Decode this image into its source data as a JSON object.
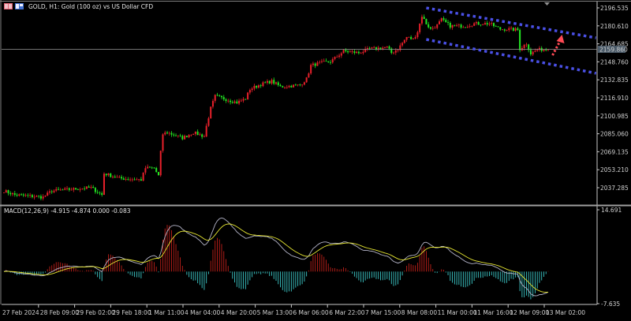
{
  "window": {
    "title": "GOLD, H1:  Gold (100 oz) vs US Dollar CFD",
    "icons": [
      "chart-window-icon",
      "chart-properties-icon"
    ]
  },
  "colors": {
    "background": "#000000",
    "bull_candle": "#e8202a",
    "bear_candle": "#22e622",
    "channel": "#4a50e6",
    "arrow": "#ff4a55",
    "macd_line": "#b4b4c8",
    "signal_line": "#e6e632",
    "hist_positive": "#c0201a",
    "hist_negative": "#3cc8c8",
    "axis": "#c8c8c8"
  },
  "chart_data": [
    {
      "type": "candlestick",
      "title": "GOLD, H1",
      "ylim": [
        2025,
        2199
      ],
      "price_ticks": [
        "2196.535",
        "2180.610",
        "2164.685",
        "2148.760",
        "2132.835",
        "2116.910",
        "2100.985",
        "2085.060",
        "2069.135",
        "2053.210",
        "2037.285"
      ],
      "current_price": "2159.860",
      "bars": 251,
      "close_keypoints": [
        [
          0,
          2034.5
        ],
        [
          5,
          2031.0
        ],
        [
          18,
          2028.9
        ],
        [
          22,
          2034.5
        ],
        [
          40,
          2037.3
        ],
        [
          45,
          2031.0
        ],
        [
          46,
          2049.9
        ],
        [
          53,
          2045.6
        ],
        [
          63,
          2044.3
        ],
        [
          65,
          2054.7
        ],
        [
          69,
          2054.7
        ],
        [
          71,
          2047.7
        ],
        [
          72,
          2068.7
        ],
        [
          73,
          2084.8
        ],
        [
          75,
          2086.2
        ],
        [
          82,
          2081.3
        ],
        [
          87,
          2086.2
        ],
        [
          92,
          2082.7
        ],
        [
          93,
          2091.8
        ],
        [
          95,
          2107.8
        ],
        [
          97,
          2118.3
        ],
        [
          101,
          2116.2
        ],
        [
          107,
          2112.7
        ],
        [
          111,
          2116.2
        ],
        [
          113,
          2124.6
        ],
        [
          118,
          2128.8
        ],
        [
          123,
          2131.6
        ],
        [
          127,
          2126.7
        ],
        [
          136,
          2128.1
        ],
        [
          139,
          2133.7
        ],
        [
          141,
          2145.5
        ],
        [
          145,
          2147.6
        ],
        [
          150,
          2149.0
        ],
        [
          156,
          2158.1
        ],
        [
          163,
          2156.7
        ],
        [
          168,
          2160.2
        ],
        [
          176,
          2161.6
        ],
        [
          178,
          2156.7
        ],
        [
          181,
          2160.2
        ],
        [
          185,
          2170.7
        ],
        [
          188,
          2168.6
        ],
        [
          190,
          2175.6
        ],
        [
          192,
          2189.5
        ],
        [
          194,
          2182.6
        ],
        [
          196,
          2177.7
        ],
        [
          199,
          2181.2
        ],
        [
          201,
          2186.1
        ],
        [
          205,
          2180.5
        ],
        [
          212,
          2180.5
        ],
        [
          216,
          2182.6
        ],
        [
          223,
          2182.6
        ],
        [
          228,
          2177.7
        ],
        [
          232,
          2177.7
        ],
        [
          236,
          2177.0
        ],
        [
          237,
          2160.2
        ],
        [
          240,
          2165.1
        ],
        [
          242,
          2156.0
        ],
        [
          245,
          2159.5
        ],
        [
          250,
          2159.86
        ]
      ],
      "annotations": {
        "channel_upper": [
          [
            194,
            2196.5
          ],
          [
            272,
            2170.0
          ]
        ],
        "channel_lower": [
          [
            194,
            2168.6
          ],
          [
            272,
            2138.6
          ]
        ],
        "forecast_arrow": [
          [
            252,
            2154.6
          ],
          [
            256,
            2170.7
          ]
        ]
      },
      "time_labels": [
        "27 Feb 2024",
        "28 Feb 09:00",
        "29 Feb 02:00",
        "29 Feb 18:00",
        "1 Mar 11:00",
        "4 Mar 04:00",
        "4 Mar 20:00",
        "5 Mar 13:00",
        "6 Mar 06:00",
        "6 Mar 22:00",
        "7 Mar 15:00",
        "8 Mar 08:00",
        "11 Mar 00:00",
        "11 Mar 16:00",
        "12 Mar 09:00",
        "13 Mar 02:00"
      ]
    },
    {
      "type": "line",
      "title": "MACD(12,26,9) -4.915 -4.874 0.000 -0.083",
      "params": {
        "fast": 12,
        "slow": 26,
        "signal": 9
      },
      "ylim": [
        -7.635,
        14.691
      ],
      "axis_labels": [
        "14.691",
        "-7.635"
      ],
      "series": [
        {
          "name": "MACD"
        },
        {
          "name": "Signal"
        },
        {
          "name": "Histogram"
        }
      ]
    }
  ]
}
